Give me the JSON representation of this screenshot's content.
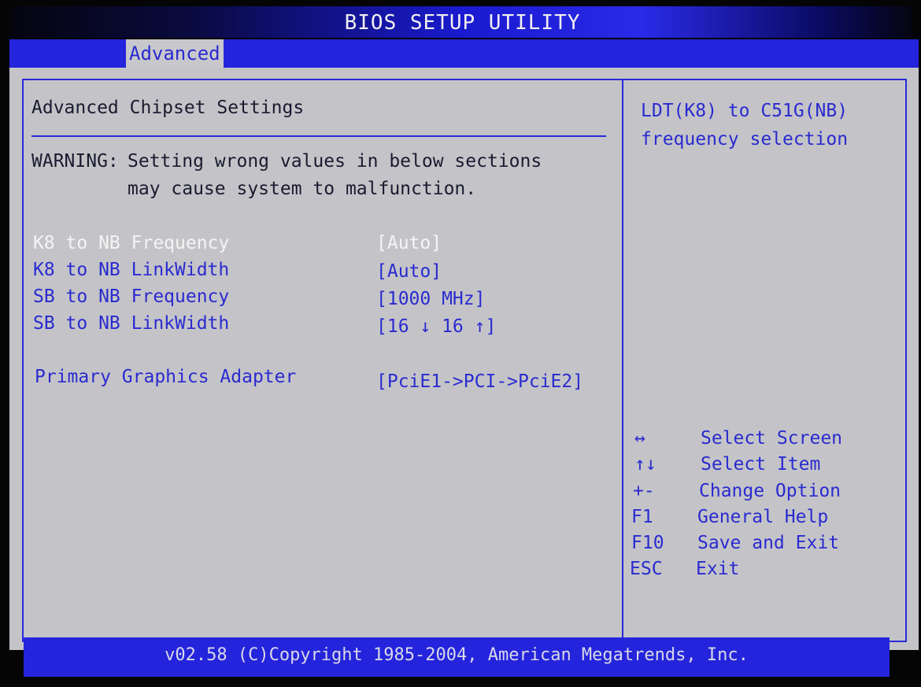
{
  "window": {
    "title": "BIOS SETUP UTILITY"
  },
  "menu": {
    "tabs": [
      {
        "label": "Advanced",
        "active": true
      }
    ]
  },
  "main": {
    "heading": "Advanced Chipset Settings",
    "warning_label": "WARNING:",
    "warning_line1": "Setting wrong values in below sections",
    "warning_line2": "may cause system to malfunction.",
    "settings": [
      {
        "label": "K8 to NB Frequency",
        "value": "[Auto]",
        "selected": true
      },
      {
        "label": "K8 to NB LinkWidth",
        "value": "[Auto]"
      },
      {
        "label": "SB to NB Frequency",
        "value": "[1000 MHz]"
      },
      {
        "label": "SB to NB LinkWidth",
        "value": "[16 ↓ 16 ↑]"
      },
      {
        "label": "Primary Graphics Adapter",
        "value": "[PciE1->PCI->PciE2]"
      }
    ]
  },
  "help": {
    "line1": "LDT(K8) to C51G(NB)",
    "line2": "frequency selection"
  },
  "keys": [
    {
      "key": "↔",
      "action": "Select Screen"
    },
    {
      "key": "↑↓",
      "action": "Select Item"
    },
    {
      "key": "+-",
      "action": "Change Option"
    },
    {
      "key": "F1",
      "action": "General Help"
    },
    {
      "key": "F10",
      "action": "Save and Exit"
    },
    {
      "key": "ESC",
      "action": "Exit"
    }
  ],
  "footer": {
    "text": "v02.58 (C)Copyright 1985-2004, American Megatrends, Inc."
  },
  "colors": {
    "text": "#2a2ad0",
    "background": "#c4c4c8",
    "bar": "#2424dc",
    "selected": "#f4f4f4"
  }
}
